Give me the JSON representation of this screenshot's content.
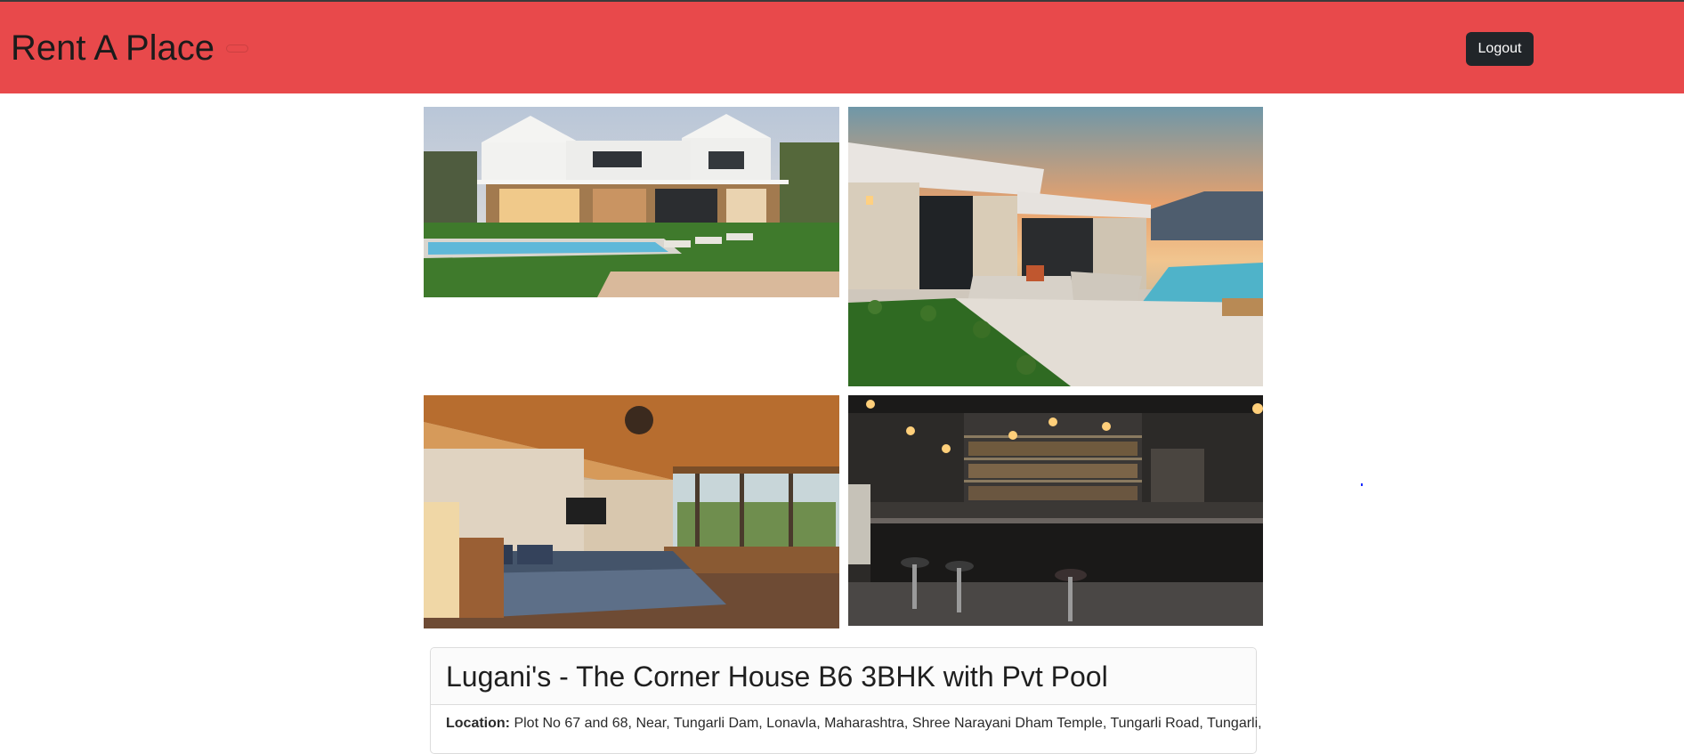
{
  "navbar": {
    "brand": "Rent A Place",
    "logout_label": "Logout",
    "color": "#e8494b"
  },
  "gallery": [
    {
      "name": "exterior-with-pool"
    },
    {
      "name": "patio-with-pool-at-sunset"
    },
    {
      "name": "bedroom"
    },
    {
      "name": "bar"
    }
  ],
  "property": {
    "title": "Lugani's - The Corner House B6 3BHK with Pvt Pool",
    "location_label": "Location:",
    "location_value": "Plot No 67 and 68, Near, Tungarli Dam, Lonavla, Maharashtra, Shree Narayani Dham Temple, Tungarli Road, Tungarli,"
  }
}
